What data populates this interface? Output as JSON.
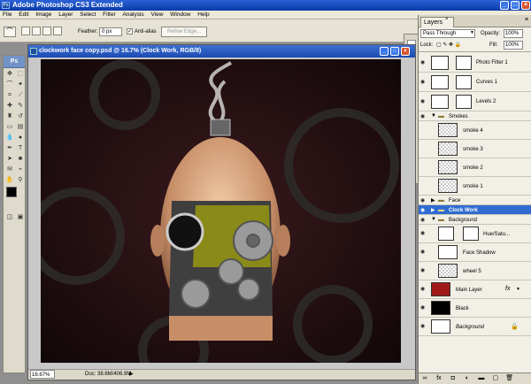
{
  "app": {
    "title": "Adobe Photoshop CS3 Extended",
    "icon_label": "Ps"
  },
  "menu": [
    "File",
    "Edit",
    "Image",
    "Layer",
    "Select",
    "Filter",
    "Analysis",
    "View",
    "Window",
    "Help"
  ],
  "options": {
    "feather_label": "Feather:",
    "feather_value": "0 px",
    "antialias_label": "Anti-alias",
    "refine_label": "Refine Edge..."
  },
  "document": {
    "title": "clockwork face copy.psd @ 16.7% (Clock Work, RGB/8)",
    "zoom": "16.67%",
    "doc_info": "Doc: 38.6M/406.9M"
  },
  "layers_panel": {
    "tab": "Layers",
    "blend_mode": "Pass Through",
    "opacity_label": "Opacity:",
    "opacity_value": "100%",
    "lock_label": "Lock:",
    "fill_label": "Fill:",
    "fill_value": "100%",
    "layers": [
      {
        "name": "Photo Filter 1",
        "kind": "adjustment",
        "visible": true
      },
      {
        "name": "Curves 1",
        "kind": "adjustment",
        "visible": true
      },
      {
        "name": "Levels 2",
        "kind": "adjustment",
        "visible": true
      },
      {
        "name": "Smokes",
        "kind": "group-open",
        "visible": true
      },
      {
        "name": "smoke 4",
        "kind": "layer",
        "visible": false
      },
      {
        "name": "smoke 3",
        "kind": "layer",
        "visible": false
      },
      {
        "name": "smoke 2",
        "kind": "layer",
        "visible": false
      },
      {
        "name": "smoke 1",
        "kind": "layer",
        "visible": false
      },
      {
        "name": "Face",
        "kind": "group",
        "visible": true
      },
      {
        "name": "Clock Work",
        "kind": "group-selected",
        "visible": true
      },
      {
        "name": "Background",
        "kind": "group-open",
        "visible": true
      },
      {
        "name": "Hue/Satu...",
        "kind": "adjustment",
        "visible": true
      },
      {
        "name": "Face Shadow",
        "kind": "layer",
        "visible": true
      },
      {
        "name": "wheel 5",
        "kind": "layer",
        "visible": true
      },
      {
        "name": "Main Layer",
        "kind": "layer-fx",
        "visible": true
      },
      {
        "name": "Black",
        "kind": "layer",
        "visible": true
      },
      {
        "name": "Background",
        "kind": "background",
        "visible": true
      }
    ]
  },
  "colors": {
    "selection": "#2f6bd1",
    "canvas_bg": "#1e0e10",
    "main_layer": "#a01818"
  }
}
